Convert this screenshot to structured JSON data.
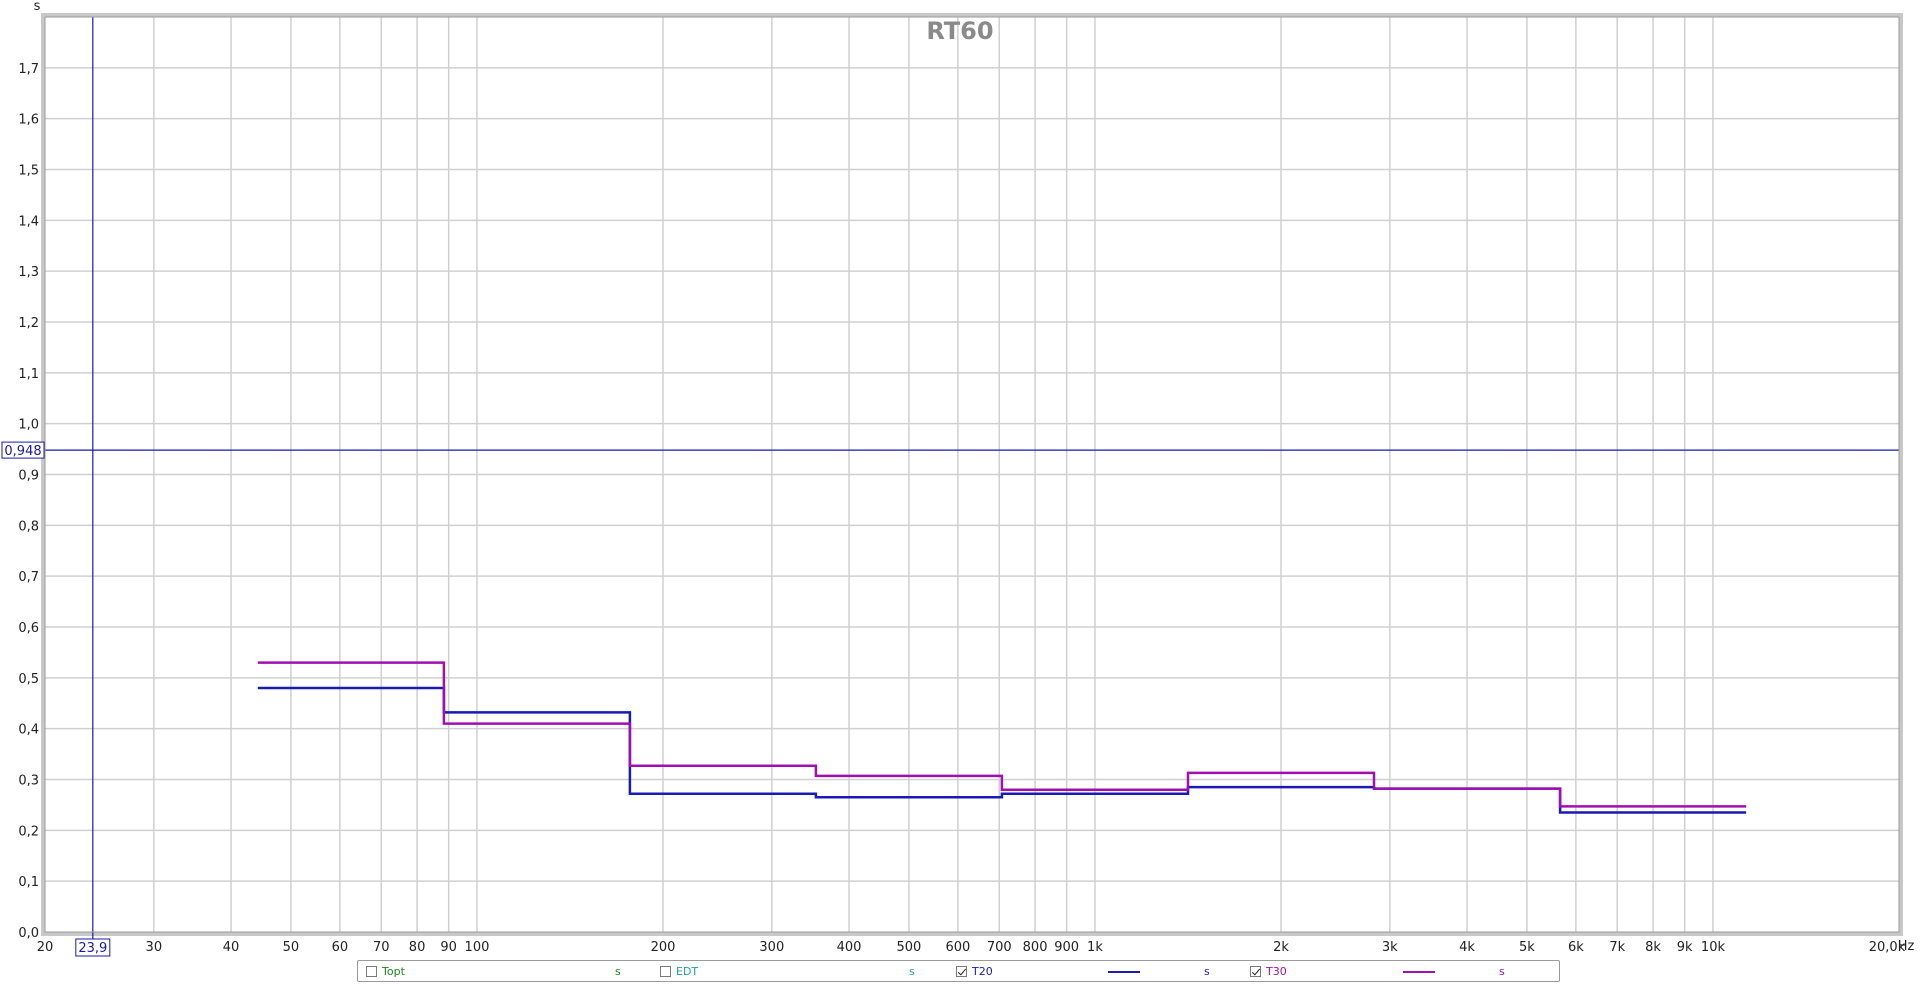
{
  "chart_data": {
    "type": "line",
    "title": "RT60",
    "ylabel": "s",
    "xunit": "Hz",
    "xscale": "log",
    "xlim": [
      20,
      20000
    ],
    "ylim": [
      0,
      1.8
    ],
    "grid": true,
    "x_ticks": [
      {
        "value": 20,
        "label": "20"
      },
      {
        "value": 30,
        "label": "30"
      },
      {
        "value": 40,
        "label": "40"
      },
      {
        "value": 50,
        "label": "50"
      },
      {
        "value": 60,
        "label": "60"
      },
      {
        "value": 70,
        "label": "70"
      },
      {
        "value": 80,
        "label": "80"
      },
      {
        "value": 90,
        "label": "90"
      },
      {
        "value": 100,
        "label": "100"
      },
      {
        "value": 200,
        "label": "200"
      },
      {
        "value": 300,
        "label": "300"
      },
      {
        "value": 400,
        "label": "400"
      },
      {
        "value": 500,
        "label": "500"
      },
      {
        "value": 600,
        "label": "600"
      },
      {
        "value": 700,
        "label": "700"
      },
      {
        "value": 800,
        "label": "800"
      },
      {
        "value": 900,
        "label": "900"
      },
      {
        "value": 1000,
        "label": "1k"
      },
      {
        "value": 2000,
        "label": "2k"
      },
      {
        "value": 3000,
        "label": "3k"
      },
      {
        "value": 4000,
        "label": "4k"
      },
      {
        "value": 5000,
        "label": "5k"
      },
      {
        "value": 6000,
        "label": "6k"
      },
      {
        "value": 7000,
        "label": "7k"
      },
      {
        "value": 8000,
        "label": "8k"
      },
      {
        "value": 9000,
        "label": "9k"
      },
      {
        "value": 10000,
        "label": "10k"
      },
      {
        "value": 20000,
        "label": "20,0k"
      }
    ],
    "y_ticks": [
      {
        "value": 0.0,
        "label": "0,0"
      },
      {
        "value": 0.1,
        "label": "0,1"
      },
      {
        "value": 0.2,
        "label": "0,2"
      },
      {
        "value": 0.3,
        "label": "0,3"
      },
      {
        "value": 0.4,
        "label": "0,4"
      },
      {
        "value": 0.5,
        "label": "0,5"
      },
      {
        "value": 0.6,
        "label": "0,6"
      },
      {
        "value": 0.7,
        "label": "0,7"
      },
      {
        "value": 0.8,
        "label": "0,8"
      },
      {
        "value": 0.9,
        "label": "0,9"
      },
      {
        "value": 1.0,
        "label": "1,0"
      },
      {
        "value": 1.1,
        "label": "1,1"
      },
      {
        "value": 1.2,
        "label": "1,2"
      },
      {
        "value": 1.3,
        "label": "1,3"
      },
      {
        "value": 1.4,
        "label": "1,4"
      },
      {
        "value": 1.5,
        "label": "1,5"
      },
      {
        "value": 1.6,
        "label": "1,6"
      },
      {
        "value": 1.7,
        "label": "1,7"
      }
    ],
    "cursor": {
      "x": 23.9,
      "x_label": "23,9",
      "y": 0.948,
      "y_label": "0,948",
      "color": "#1a1aa8"
    },
    "series": [
      {
        "name": "T20",
        "color": "#1a1ab4",
        "bands": [
          {
            "f_low": 44.2,
            "f_high": 88.4,
            "value": 0.48
          },
          {
            "f_low": 88.4,
            "f_high": 176.8,
            "value": 0.432
          },
          {
            "f_low": 176.8,
            "f_high": 353.6,
            "value": 0.272
          },
          {
            "f_low": 353.6,
            "f_high": 707.1,
            "value": 0.265
          },
          {
            "f_low": 707.1,
            "f_high": 1414.2,
            "value": 0.272
          },
          {
            "f_low": 1414.2,
            "f_high": 2828.4,
            "value": 0.285
          },
          {
            "f_low": 2828.4,
            "f_high": 5656.9,
            "value": 0.282
          },
          {
            "f_low": 5656.9,
            "f_high": 11313.7,
            "value": 0.235
          }
        ]
      },
      {
        "name": "T30",
        "color": "#a010b0",
        "bands": [
          {
            "f_low": 44.2,
            "f_high": 88.4,
            "value": 0.53
          },
          {
            "f_low": 88.4,
            "f_high": 176.8,
            "value": 0.41
          },
          {
            "f_low": 176.8,
            "f_high": 353.6,
            "value": 0.327
          },
          {
            "f_low": 353.6,
            "f_high": 707.1,
            "value": 0.307
          },
          {
            "f_low": 707.1,
            "f_high": 1414.2,
            "value": 0.28
          },
          {
            "f_low": 1414.2,
            "f_high": 2828.4,
            "value": 0.313
          },
          {
            "f_low": 2828.4,
            "f_high": 5656.9,
            "value": 0.282
          },
          {
            "f_low": 5656.9,
            "f_high": 11313.7,
            "value": 0.247
          }
        ]
      }
    ]
  },
  "legend": {
    "items": [
      {
        "label": "Topt",
        "checked": false,
        "color": "#1a8a1a",
        "unit": "s",
        "swatch": false
      },
      {
        "label": "EDT",
        "checked": false,
        "color": "#20a0a0",
        "unit": "s",
        "swatch": false
      },
      {
        "label": "T20",
        "checked": true,
        "color": "#1a1ab4",
        "unit": "s",
        "swatch": true
      },
      {
        "label": "T30",
        "checked": true,
        "color": "#a010b0",
        "unit": "s",
        "swatch": true
      }
    ]
  }
}
